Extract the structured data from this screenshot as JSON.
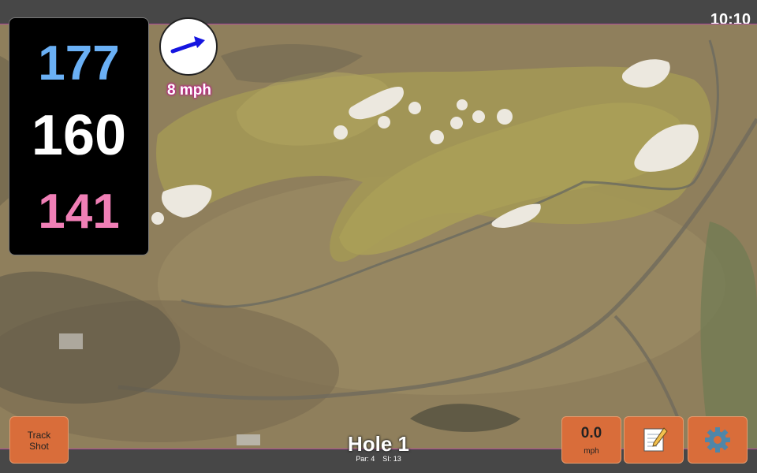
{
  "status_bar": {
    "time": "10:10"
  },
  "distances": {
    "back": "177",
    "center": "160",
    "front": "141"
  },
  "wind": {
    "speed_label": "8 mph",
    "direction": "east"
  },
  "buttons": {
    "track_shot_label": "Track\nShot",
    "speed_value": "0.0",
    "speed_unit": "mph",
    "notes_icon": "notepad-icon",
    "settings_icon": "gear-icon"
  },
  "hole": {
    "title": "Hole 1",
    "par_label": "Par: 4",
    "si_label": "SI: 13"
  },
  "colors": {
    "back_distance": "#6ab0f5",
    "center_distance": "#ffffff",
    "front_distance": "#f07fb6",
    "button": "#d96d3a",
    "accent_border": "#b04a9a"
  }
}
